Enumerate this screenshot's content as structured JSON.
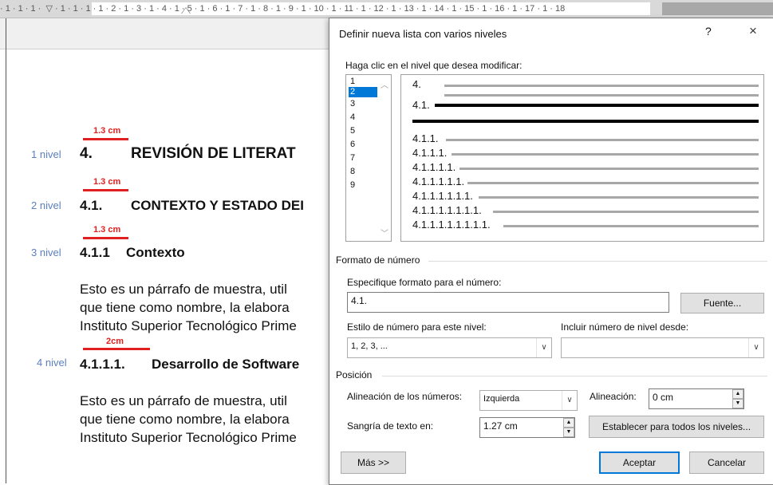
{
  "ruler": {
    "numbers": "· 1 · 1 · 1 ·  ▽ · 1 · 1 · 1 · 1 · 2 · 1 · 3 · 1 · 4 · 1 · 5 · 1 · 6 · 1 · 7 · 1 · 8 · 1 · 9 · 1 · 10 · 1 · 11 · 1 · 12 · 1 · 13 · 1 · 14 · 1 · 15 · 1 · 16 · 1 · 17 · 1 · 18"
  },
  "document": {
    "levels": [
      {
        "level": "1 nivel",
        "measure": "1.3 cm",
        "num": "4.",
        "text": "REVISIÓN DE LITERAT"
      },
      {
        "level": "2 nivel",
        "measure": "1.3 cm",
        "num": "4.1.",
        "text": "CONTEXTO Y ESTADO DEI"
      },
      {
        "level": "3 nivel",
        "measure": "1.3 cm",
        "num": "4.1.1",
        "text": "Contexto"
      },
      {
        "level": "4 nivel",
        "measure": "2cm",
        "num": "4.1.1.1.",
        "text": "Desarrollo de Software"
      }
    ],
    "para1": [
      "Esto es un párrafo de muestra, util",
      "que tiene como nombre, la elabora",
      "Instituto Superior Tecnológico Prime"
    ],
    "para2": [
      "Esto es un párrafo de muestra, util",
      "que tiene como nombre, la elabora",
      "Instituto Superior Tecnológico Prime"
    ]
  },
  "dialog": {
    "title": "Definir nueva lista con varios niveles",
    "help": "?",
    "close": "×",
    "click_level_label": "Haga clic en el nivel que desea modificar:",
    "levels_list": [
      "1",
      "2",
      "3",
      "4",
      "5",
      "6",
      "7",
      "8",
      "9"
    ],
    "selected_level": "2",
    "preview": [
      "4.",
      "4.1.",
      "4.1.1.",
      "4.1.1.1.",
      "4.1.1.1.1.",
      "4.1.1.1.1.1.",
      "4.1.1.1.1.1.1.",
      "4.1.1.1.1.1.1.1.",
      "4.1.1.1.1.1.1.1.1."
    ],
    "number_format_group": "Formato de número",
    "format_label": "Especifique formato para el número:",
    "format_value": "4.1.",
    "font_button": "Fuente...",
    "style_label": "Estilo de número para este nivel:",
    "style_value": "1, 2, 3, ...",
    "include_label": "Incluir número de nivel desde:",
    "include_value": "",
    "position_group": "Posición",
    "alignment_label": "Alineación de los números:",
    "alignment_value": "Izquierda",
    "align_at_label": "Alineación:",
    "align_at_value": "0 cm",
    "indent_label": "Sangría de texto en:",
    "indent_value": "1.27 cm",
    "set_all_button": "Establecer para todos los niveles...",
    "more_button": "Más >>",
    "ok_button": "Aceptar",
    "cancel_button": "Cancelar"
  },
  "colors": {
    "accent": "#0078d7",
    "level_label": "#5b7fbf",
    "measure": "#e02020"
  }
}
